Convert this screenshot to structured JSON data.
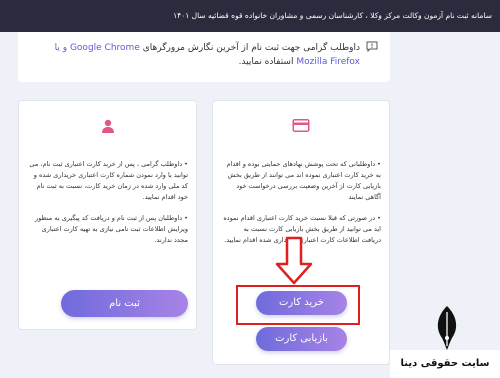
{
  "header": {
    "title": "سامانه ثبت نام آزمون وکالت مرکز وکلا ، کارشناسان رسمی و مشاوران خانواده قوه قضائیه سال ۱۴۰۱"
  },
  "notice": {
    "icon": "chat-alert-icon",
    "text_before": "داوطلب گرامی جهت ثبت نام از آخرین نگارش مرورگرهای ",
    "browsers": "Google Chrome و یا Mozilla Firefox",
    "text_after": " استفاده نمایید."
  },
  "register_card": {
    "icon": "user-icon",
    "paragraph1": "• داوطلب گرامی ، پس از خرید کارت اعتباری ثبت نام، می توانید با وارد نمودن شماره کارت اعتباری خریداری شده و کد ملی وارد شده در زمان خرید کارت، نسبت به ثبت نام خود اقدام نمایید.",
    "paragraph2": "• داوطلبان پس از ثبت نام و دریافت کد پیگیری به منظور ویرایش اطلاعات ثبت نامی نیازی به تهیه کارت اعتباری مجدد ندارند.",
    "button_label": "ثبت نام"
  },
  "card_purchase": {
    "icon": "credit-card-icon",
    "paragraph1": "• داوطلبانی که تحت پوشش نهادهای حمایتی بوده و اقدام به خرید کارت اعتباری نموده اند می توانند از طریق بخش بازیابی کارت از آخرین وضعیت بررسی درخواست خود آگاهی نمایند",
    "paragraph2": "• در صورتی که قبلا نسبت خرید کارت اعتباری اقدام نموده اید می توانید از طریق بخش بازیابی کارت نسبت به دریافت اطلاعات کارت اعتباری خریداری شده اقدام نمایید.",
    "buy_button_label": "خرید کارت",
    "retrieve_button_label": "بازیابی کارت"
  },
  "annotation": {
    "highlight_color": "#e02020"
  },
  "watermark": {
    "text": "سایت حقوقی دینا"
  }
}
